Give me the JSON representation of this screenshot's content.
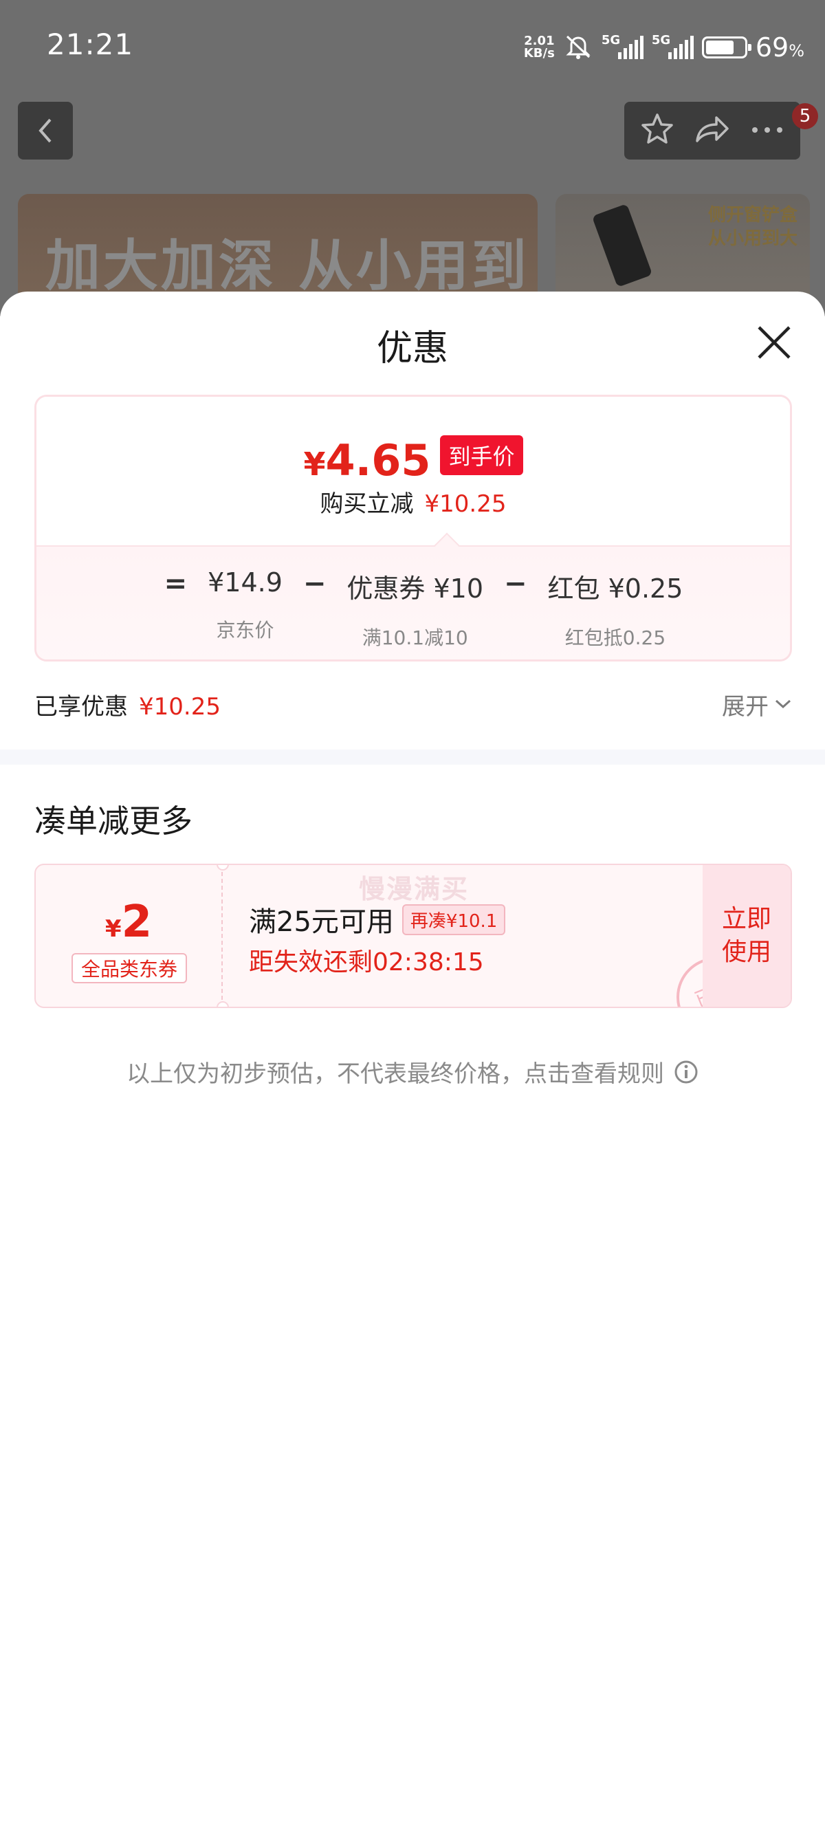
{
  "status_bar": {
    "time": "21:21",
    "net_speed_value": "2.01",
    "net_speed_unit": "KB/s",
    "sim1": "5G",
    "sim2": "5G",
    "battery_level": 0.69,
    "battery_percent": "69",
    "percent_sign": "%"
  },
  "background_page": {
    "banner_text": "加大加深 从小用到大",
    "banner2_line1": "侧开窗铲盒",
    "banner2_line2": "从小用到大",
    "cart_badge": "5"
  },
  "sheet": {
    "title": "优惠",
    "price_card": {
      "currency": "¥",
      "final_price": "4.65",
      "final_tag": "到手价",
      "save_label": "购买立减",
      "save_value": "¥10.25",
      "formula": {
        "equals": "=",
        "minus": "−",
        "items": [
          {
            "top": "¥14.9",
            "sub": "京东价"
          },
          {
            "top": "优惠券 ¥10",
            "sub": "满10.1减10"
          },
          {
            "top": "红包 ¥0.25",
            "sub": "红包抵0.25"
          }
        ]
      }
    },
    "enjoyed": {
      "label": "已享优惠",
      "value": "¥10.25",
      "expand": "展开"
    },
    "more_section": {
      "title": "凑单减更多",
      "coupon": {
        "currency": "¥",
        "amount": "2",
        "type": "全品类东券",
        "watermark": "慢漫满买",
        "condition": "满25元可用",
        "more_needed": "再凑¥10.1",
        "countdown": "距失效还剩02:38:15",
        "stamp": "已领",
        "use_line1": "立即",
        "use_line2": "使用"
      }
    },
    "disclaimer": "以上仅为初步预估，不代表最终价格，点击查看规则"
  },
  "colors": {
    "accent_red": "#e2231a",
    "tag_red": "#f0142e",
    "card_border": "#fbdfe4"
  }
}
